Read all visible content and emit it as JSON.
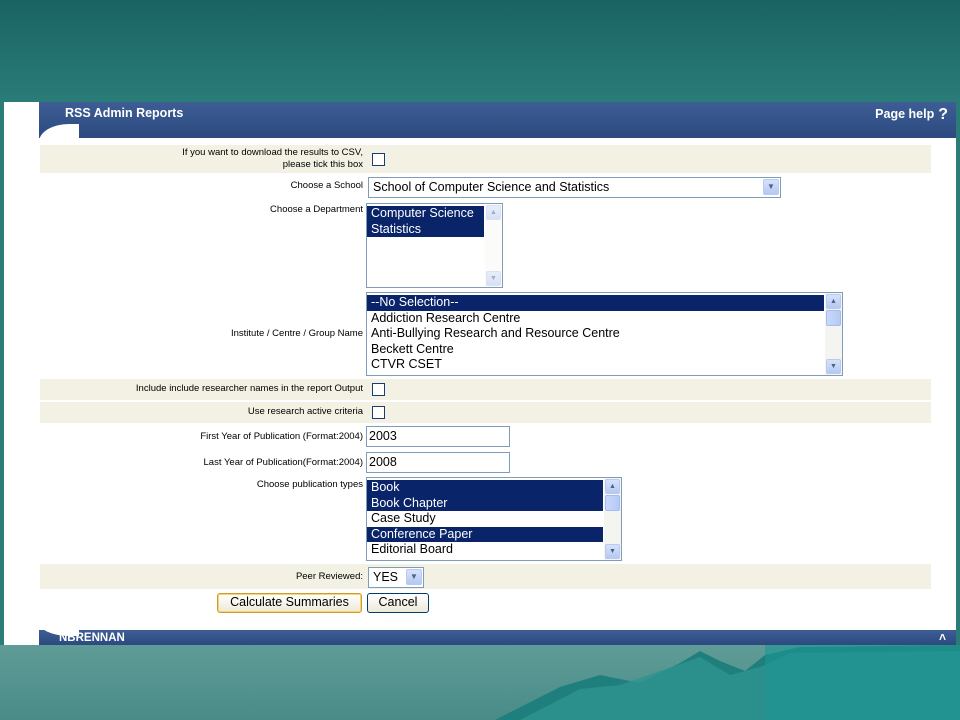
{
  "header": {
    "title": "RSS Admin Reports",
    "help_label": "Page help",
    "help_glyph": "?"
  },
  "form": {
    "csv": {
      "label_line1": "If you want to download the results to CSV,",
      "label_line2": "please tick this box"
    },
    "school": {
      "label": "Choose a School",
      "value": "School of Computer Science and Statistics"
    },
    "department": {
      "label": "Choose a Department",
      "options": [
        "Computer Science",
        "Statistics"
      ]
    },
    "institute": {
      "label": "Institute / Centre / Group Name",
      "options": [
        "--No Selection--",
        "Addiction Research Centre",
        "Anti-Bullying Research and Resource Centre",
        "Beckett Centre",
        "CTVR CSET"
      ]
    },
    "researcher_names": {
      "label": "Include include researcher names in the report Output"
    },
    "research_active": {
      "label": "Use research active criteria"
    },
    "first_year": {
      "label": "First Year of Publication (Format:2004)",
      "value": "2003"
    },
    "last_year": {
      "label": "Last Year of Publication(Format:2004)",
      "value": "2008"
    },
    "pub_types": {
      "label": "Choose publication types",
      "options": [
        "Book",
        "Book Chapter",
        "Case Study",
        "Conference Paper",
        "Editorial Board"
      ]
    },
    "peer_reviewed": {
      "label": "Peer Reviewed:",
      "value": "YES"
    },
    "calculate_label": "Calculate Summaries",
    "cancel_label": "Cancel"
  },
  "footer": {
    "user": "NBRENNAN",
    "collapse_glyph": "˄"
  },
  "colors": {
    "header": "#2c4a80",
    "selected": "#0a246a",
    "row_shade": "#f3f1e3",
    "slide_bg": "#2a7c79"
  }
}
